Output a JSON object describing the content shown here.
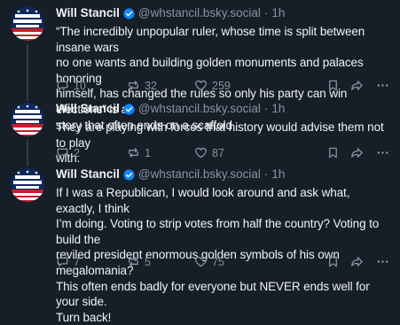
{
  "posts": [
    {
      "author": "Will Stancil",
      "handle": "@whstancil.bsky.social",
      "separator": "·",
      "time": "1h",
      "text": "“The incredibly unpopular ruler, whose time is split between insane wars\nno one wants and building golden monuments and palaces honoring\nhimself, has changed the rules so only his party can win elections” is a\nstory that often ends on a scaffold",
      "replies": "10",
      "reposts": "32",
      "likes": "259"
    },
    {
      "author": "Will Stancil",
      "handle": "@whstancil.bsky.social",
      "separator": "·",
      "time": "1h",
      "text": "They are playing with forces that history would advise them not to play\nwith.",
      "replies": "2",
      "reposts": "1",
      "likes": "87"
    },
    {
      "author": "Will Stancil",
      "handle": "@whstancil.bsky.social",
      "separator": "·",
      "time": "1h",
      "text": "If I was a Republican, I would look around and ask what, exactly, I think\nI’m doing. Voting to strip votes from half the country? Voting to build the\nreviled president enormous golden symbols of his own megalomania?\nThis often ends badly for everyone but NEVER ends well for your side.\nTurn back!",
      "replies": "7",
      "reposts": "5",
      "likes": "75"
    }
  ],
  "colors": {
    "background": "#161e27",
    "text": "#f1f3f5",
    "muted": "#8794a5",
    "verified": "#1083fe",
    "thread_line": "#2e3b4b"
  },
  "icons": [
    "verified-badge-icon",
    "reply-icon",
    "repost-icon",
    "like-icon",
    "bookmark-icon",
    "share-icon",
    "more-icon"
  ]
}
